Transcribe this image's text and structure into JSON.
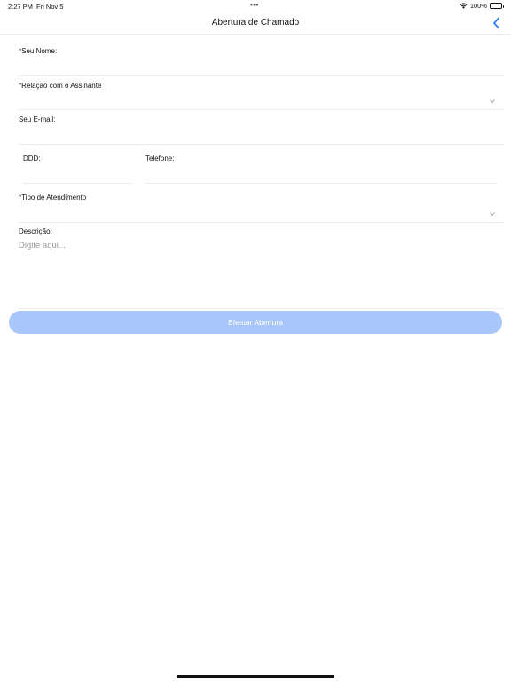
{
  "status_bar": {
    "time": "2:27 PM",
    "date": "Fri Nov 5",
    "battery": "100%",
    "dots": "•••"
  },
  "nav": {
    "title": "Abertura de Chamado",
    "back_icon": "chevron-left-icon",
    "accent_color": "#2f7cf6"
  },
  "form": {
    "nome_label": "*Seu Nome:",
    "relacao_label": "*Relação com o Assinante",
    "email_label": "Seu E-mail:",
    "ddd_label": "DDD:",
    "telefone_label": "Telefone:",
    "tipo_label": "*Tipo de Atendimento",
    "descricao_label": "Descrição:",
    "descricao_placeholder": "Digite aqui..."
  },
  "submit": {
    "label": "Efetuar Abertura",
    "color": "#a8c6fa"
  }
}
